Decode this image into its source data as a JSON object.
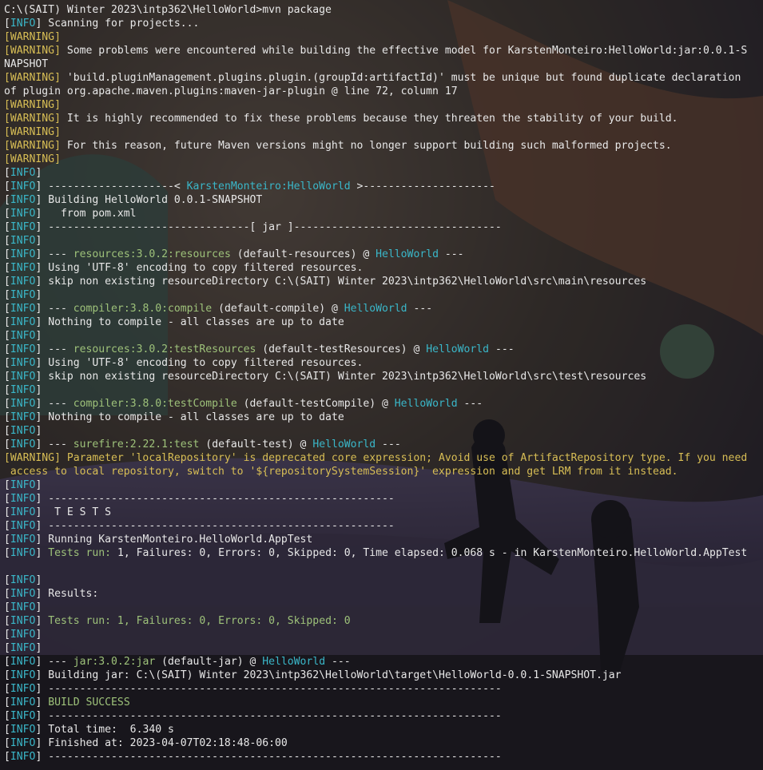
{
  "colors": {
    "info": "#3ab7c9",
    "warning": "#d8be55",
    "green": "#9ec27a",
    "text": "#e8e8e8",
    "background": "#1b1a1f"
  },
  "lines": [
    [
      {
        "t": "C:\\(SAIT) Winter 2023\\intp362\\HelloWorld>mvn package"
      }
    ],
    [
      {
        "t": "["
      },
      {
        "t": "INFO",
        "c": "cyan"
      },
      {
        "t": "] Scanning for projects..."
      }
    ],
    [
      {
        "t": "[WARNING]",
        "c": "yellow"
      }
    ],
    [
      {
        "t": "[WARNING]",
        "c": "yellow"
      },
      {
        "t": " Some problems were encountered while building the effective model for KarstenMonteiro:HelloWorld:jar:0.0.1-S"
      }
    ],
    [
      {
        "t": "NAPSHOT"
      }
    ],
    [
      {
        "t": "[WARNING]",
        "c": "yellow"
      },
      {
        "t": " 'build.pluginManagement.plugins.plugin.(groupId:artifactId)' must be unique but found duplicate declaration"
      }
    ],
    [
      {
        "t": "of plugin org.apache.maven.plugins:maven-jar-plugin @ line 72, column 17"
      }
    ],
    [
      {
        "t": "[WARNING]",
        "c": "yellow"
      }
    ],
    [
      {
        "t": "[WARNING]",
        "c": "yellow"
      },
      {
        "t": " It is highly recommended to fix these problems because they threaten the stability of your build."
      }
    ],
    [
      {
        "t": "[WARNING]",
        "c": "yellow"
      }
    ],
    [
      {
        "t": "[WARNING]",
        "c": "yellow"
      },
      {
        "t": " For this reason, future Maven versions might no longer support building such malformed projects."
      }
    ],
    [
      {
        "t": "[WARNING]",
        "c": "yellow"
      }
    ],
    [
      {
        "t": "["
      },
      {
        "t": "INFO",
        "c": "cyan"
      },
      {
        "t": "]"
      }
    ],
    [
      {
        "t": "["
      },
      {
        "t": "INFO",
        "c": "cyan"
      },
      {
        "t": "] --------------------< "
      },
      {
        "t": "KarstenMonteiro:HelloWorld",
        "c": "cyan"
      },
      {
        "t": " >---------------------"
      }
    ],
    [
      {
        "t": "["
      },
      {
        "t": "INFO",
        "c": "cyan"
      },
      {
        "t": "] Building HelloWorld 0.0.1-SNAPSHOT"
      }
    ],
    [
      {
        "t": "["
      },
      {
        "t": "INFO",
        "c": "cyan"
      },
      {
        "t": "]   from pom.xml"
      }
    ],
    [
      {
        "t": "["
      },
      {
        "t": "INFO",
        "c": "cyan"
      },
      {
        "t": "] --------------------------------[ jar ]---------------------------------"
      }
    ],
    [
      {
        "t": "["
      },
      {
        "t": "INFO",
        "c": "cyan"
      },
      {
        "t": "]"
      }
    ],
    [
      {
        "t": "["
      },
      {
        "t": "INFO",
        "c": "cyan"
      },
      {
        "t": "] --- "
      },
      {
        "t": "resources:3.0.2:resources",
        "c": "green"
      },
      {
        "t": " (default-resources) @ "
      },
      {
        "t": "HelloWorld",
        "c": "cyan"
      },
      {
        "t": " ---"
      }
    ],
    [
      {
        "t": "["
      },
      {
        "t": "INFO",
        "c": "cyan"
      },
      {
        "t": "] Using 'UTF-8' encoding to copy filtered resources."
      }
    ],
    [
      {
        "t": "["
      },
      {
        "t": "INFO",
        "c": "cyan"
      },
      {
        "t": "] skip non existing resourceDirectory C:\\(SAIT) Winter 2023\\intp362\\HelloWorld\\src\\main\\resources"
      }
    ],
    [
      {
        "t": "["
      },
      {
        "t": "INFO",
        "c": "cyan"
      },
      {
        "t": "]"
      }
    ],
    [
      {
        "t": "["
      },
      {
        "t": "INFO",
        "c": "cyan"
      },
      {
        "t": "] --- "
      },
      {
        "t": "compiler:3.8.0:compile",
        "c": "green"
      },
      {
        "t": " (default-compile) @ "
      },
      {
        "t": "HelloWorld",
        "c": "cyan"
      },
      {
        "t": " ---"
      }
    ],
    [
      {
        "t": "["
      },
      {
        "t": "INFO",
        "c": "cyan"
      },
      {
        "t": "] Nothing to compile - all classes are up to date"
      }
    ],
    [
      {
        "t": "["
      },
      {
        "t": "INFO",
        "c": "cyan"
      },
      {
        "t": "]"
      }
    ],
    [
      {
        "t": "["
      },
      {
        "t": "INFO",
        "c": "cyan"
      },
      {
        "t": "] --- "
      },
      {
        "t": "resources:3.0.2:testResources",
        "c": "green"
      },
      {
        "t": " (default-testResources) @ "
      },
      {
        "t": "HelloWorld",
        "c": "cyan"
      },
      {
        "t": " ---"
      }
    ],
    [
      {
        "t": "["
      },
      {
        "t": "INFO",
        "c": "cyan"
      },
      {
        "t": "] Using 'UTF-8' encoding to copy filtered resources."
      }
    ],
    [
      {
        "t": "["
      },
      {
        "t": "INFO",
        "c": "cyan"
      },
      {
        "t": "] skip non existing resourceDirectory C:\\(SAIT) Winter 2023\\intp362\\HelloWorld\\src\\test\\resources"
      }
    ],
    [
      {
        "t": "["
      },
      {
        "t": "INFO",
        "c": "cyan"
      },
      {
        "t": "]"
      }
    ],
    [
      {
        "t": "["
      },
      {
        "t": "INFO",
        "c": "cyan"
      },
      {
        "t": "] --- "
      },
      {
        "t": "compiler:3.8.0:testCompile",
        "c": "green"
      },
      {
        "t": " (default-testCompile) @ "
      },
      {
        "t": "HelloWorld",
        "c": "cyan"
      },
      {
        "t": " ---"
      }
    ],
    [
      {
        "t": "["
      },
      {
        "t": "INFO",
        "c": "cyan"
      },
      {
        "t": "] Nothing to compile - all classes are up to date"
      }
    ],
    [
      {
        "t": "["
      },
      {
        "t": "INFO",
        "c": "cyan"
      },
      {
        "t": "]"
      }
    ],
    [
      {
        "t": "["
      },
      {
        "t": "INFO",
        "c": "cyan"
      },
      {
        "t": "] --- "
      },
      {
        "t": "surefire:2.22.1:test",
        "c": "green"
      },
      {
        "t": " (default-test) @ "
      },
      {
        "t": "HelloWorld",
        "c": "cyan"
      },
      {
        "t": " ---"
      }
    ],
    [
      {
        "t": "[WARNING]",
        "c": "yellow"
      },
      {
        "t": " Parameter 'localRepository' is deprecated core expression; Avoid use of ArtifactRepository type. If you need",
        "c": "yellow"
      }
    ],
    [
      {
        "t": " access to local repository, switch to '${repositorySystemSession}' expression and get LRM from it instead.",
        "c": "yellow"
      }
    ],
    [
      {
        "t": "["
      },
      {
        "t": "INFO",
        "c": "cyan"
      },
      {
        "t": "]"
      }
    ],
    [
      {
        "t": "["
      },
      {
        "t": "INFO",
        "c": "cyan"
      },
      {
        "t": "] -------------------------------------------------------"
      }
    ],
    [
      {
        "t": "["
      },
      {
        "t": "INFO",
        "c": "cyan"
      },
      {
        "t": "]  T E S T S"
      }
    ],
    [
      {
        "t": "["
      },
      {
        "t": "INFO",
        "c": "cyan"
      },
      {
        "t": "] -------------------------------------------------------"
      }
    ],
    [
      {
        "t": "["
      },
      {
        "t": "INFO",
        "c": "cyan"
      },
      {
        "t": "] Running KarstenMonteiro.HelloWorld.AppTest"
      }
    ],
    [
      {
        "t": "["
      },
      {
        "t": "INFO",
        "c": "cyan"
      },
      {
        "t": "] "
      },
      {
        "t": "Tests run: ",
        "c": "green"
      },
      {
        "t": "1, Failures: 0, Errors: 0, Skipped: 0, Time elapsed: 0.068 s - in KarstenMonteiro.HelloWorld.AppTest"
      }
    ],
    [
      {
        "t": ""
      }
    ],
    [
      {
        "t": "["
      },
      {
        "t": "INFO",
        "c": "cyan"
      },
      {
        "t": "]"
      }
    ],
    [
      {
        "t": "["
      },
      {
        "t": "INFO",
        "c": "cyan"
      },
      {
        "t": "] Results:"
      }
    ],
    [
      {
        "t": "["
      },
      {
        "t": "INFO",
        "c": "cyan"
      },
      {
        "t": "]"
      }
    ],
    [
      {
        "t": "["
      },
      {
        "t": "INFO",
        "c": "cyan"
      },
      {
        "t": "] "
      },
      {
        "t": "Tests run: 1, Failures: 0, Errors: 0, Skipped: 0",
        "c": "green"
      }
    ],
    [
      {
        "t": "["
      },
      {
        "t": "INFO",
        "c": "cyan"
      },
      {
        "t": "]"
      }
    ],
    [
      {
        "t": "["
      },
      {
        "t": "INFO",
        "c": "cyan"
      },
      {
        "t": "]"
      }
    ],
    [
      {
        "t": "["
      },
      {
        "t": "INFO",
        "c": "cyan"
      },
      {
        "t": "] --- "
      },
      {
        "t": "jar:3.0.2:jar",
        "c": "green"
      },
      {
        "t": " (default-jar) @ "
      },
      {
        "t": "HelloWorld",
        "c": "cyan"
      },
      {
        "t": " ---"
      }
    ],
    [
      {
        "t": "["
      },
      {
        "t": "INFO",
        "c": "cyan"
      },
      {
        "t": "] Building jar: C:\\(SAIT) Winter 2023\\intp362\\HelloWorld\\target\\HelloWorld-0.0.1-SNAPSHOT.jar"
      }
    ],
    [
      {
        "t": "["
      },
      {
        "t": "INFO",
        "c": "cyan"
      },
      {
        "t": "] ------------------------------------------------------------------------"
      }
    ],
    [
      {
        "t": "["
      },
      {
        "t": "INFO",
        "c": "cyan"
      },
      {
        "t": "] "
      },
      {
        "t": "BUILD SUCCESS",
        "c": "green"
      }
    ],
    [
      {
        "t": "["
      },
      {
        "t": "INFO",
        "c": "cyan"
      },
      {
        "t": "] ------------------------------------------------------------------------"
      }
    ],
    [
      {
        "t": "["
      },
      {
        "t": "INFO",
        "c": "cyan"
      },
      {
        "t": "] Total time:  6.340 s"
      }
    ],
    [
      {
        "t": "["
      },
      {
        "t": "INFO",
        "c": "cyan"
      },
      {
        "t": "] Finished at: 2023-04-07T02:18:48-06:00"
      }
    ],
    [
      {
        "t": "["
      },
      {
        "t": "INFO",
        "c": "cyan"
      },
      {
        "t": "] ------------------------------------------------------------------------"
      }
    ]
  ]
}
